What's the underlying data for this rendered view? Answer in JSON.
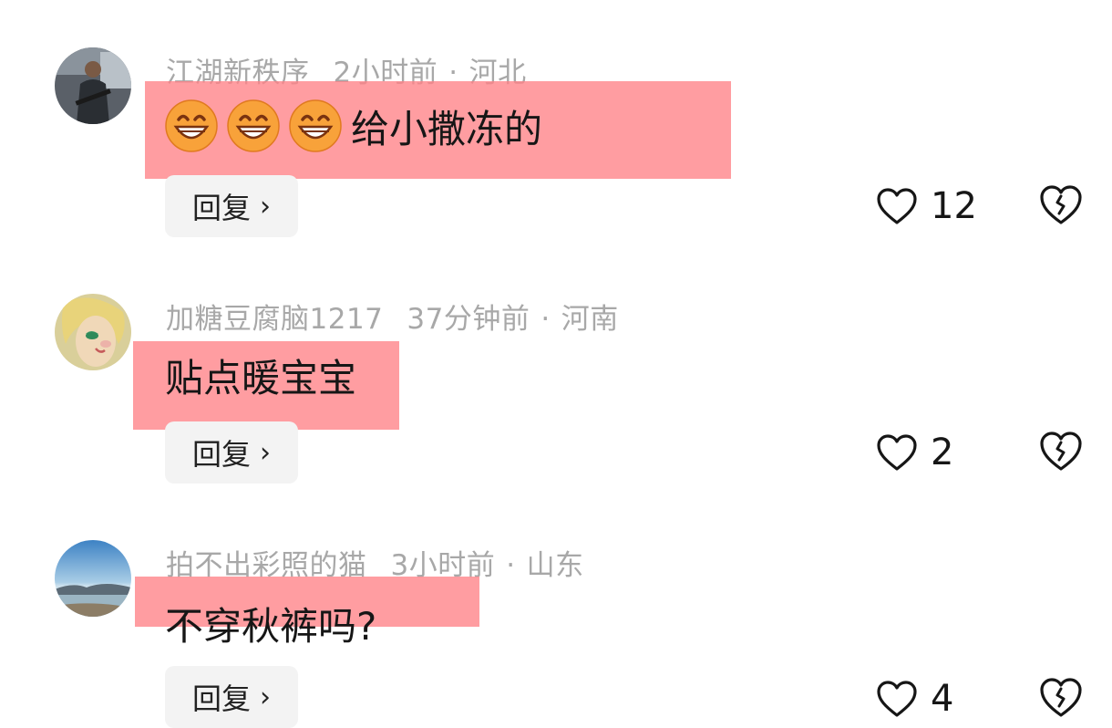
{
  "comments": [
    {
      "username": "江湖新秩序",
      "time": "2小时前",
      "location": "河北",
      "text": "给小撒冻的",
      "emoji_prefix": [
        "grinning-face-icon",
        "grinning-face-icon",
        "grinning-face-icon"
      ],
      "reply_label": "回复",
      "likes": "12"
    },
    {
      "username": "加糖豆腐脑1217",
      "time": "37分钟前",
      "location": "河南",
      "text": "贴点暖宝宝",
      "reply_label": "回复",
      "likes": "2"
    },
    {
      "username": "拍不出彩照的猫",
      "time": "3小时前",
      "location": "山东",
      "text": "不穿秋裤吗?",
      "reply_label": "回复",
      "likes": "4"
    }
  ],
  "colors": {
    "highlight": "#ff8287",
    "meta_text": "#a8a8a8",
    "body_text": "#161616",
    "reply_bg": "#f3f3f3"
  }
}
